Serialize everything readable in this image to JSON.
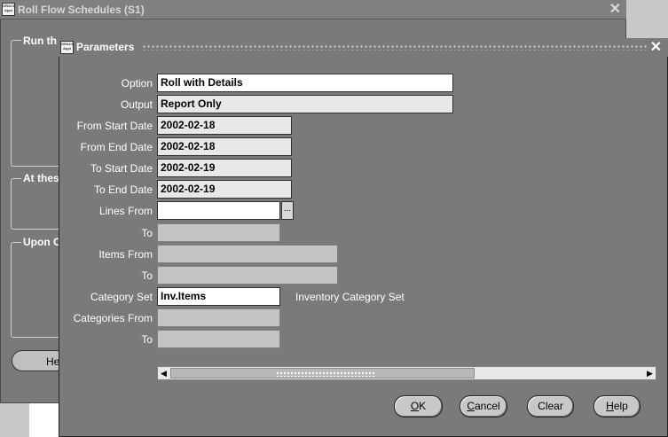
{
  "background_window": {
    "title": "Roll Flow Schedules (S1)",
    "close_glyph": "✕",
    "groups": [
      {
        "label": "Run th"
      },
      {
        "label": "At thes"
      },
      {
        "label": "Upon C"
      }
    ],
    "button_label": "He"
  },
  "dialog": {
    "title": "Parameters",
    "close_glyph": "✕",
    "fields": {
      "option": {
        "label": "Option",
        "value": "Roll with Details"
      },
      "output": {
        "label": "Output",
        "value": "Report Only"
      },
      "from_start_date": {
        "label": "From Start Date",
        "value": "2002-02-18"
      },
      "from_end_date": {
        "label": "From End Date",
        "value": "2002-02-18"
      },
      "to_start_date": {
        "label": "To Start Date",
        "value": "2002-02-19"
      },
      "to_end_date": {
        "label": "To End Date",
        "value": "2002-02-19"
      },
      "lines_from": {
        "label": "Lines From",
        "value": ""
      },
      "lines_to": {
        "label": "To",
        "value": ""
      },
      "items_from": {
        "label": "Items From",
        "value": ""
      },
      "items_to": {
        "label": "To",
        "value": ""
      },
      "category_set": {
        "label": "Category Set",
        "value": "Inv.Items",
        "description": "Inventory Category Set"
      },
      "categories_from": {
        "label": "Categories From",
        "value": ""
      },
      "categories_to": {
        "label": "To",
        "value": ""
      }
    },
    "lov_glyph": "...",
    "buttons": {
      "ok": {
        "mnemonic": "O",
        "rest": "K"
      },
      "cancel": {
        "mnemonic": "C",
        "rest": "ancel"
      },
      "clear": {
        "label": "Clear"
      },
      "help": {
        "mnemonic": "H",
        "rest": "elp"
      }
    },
    "scroll_left_glyph": "◀",
    "scroll_right_glyph": "▶"
  }
}
